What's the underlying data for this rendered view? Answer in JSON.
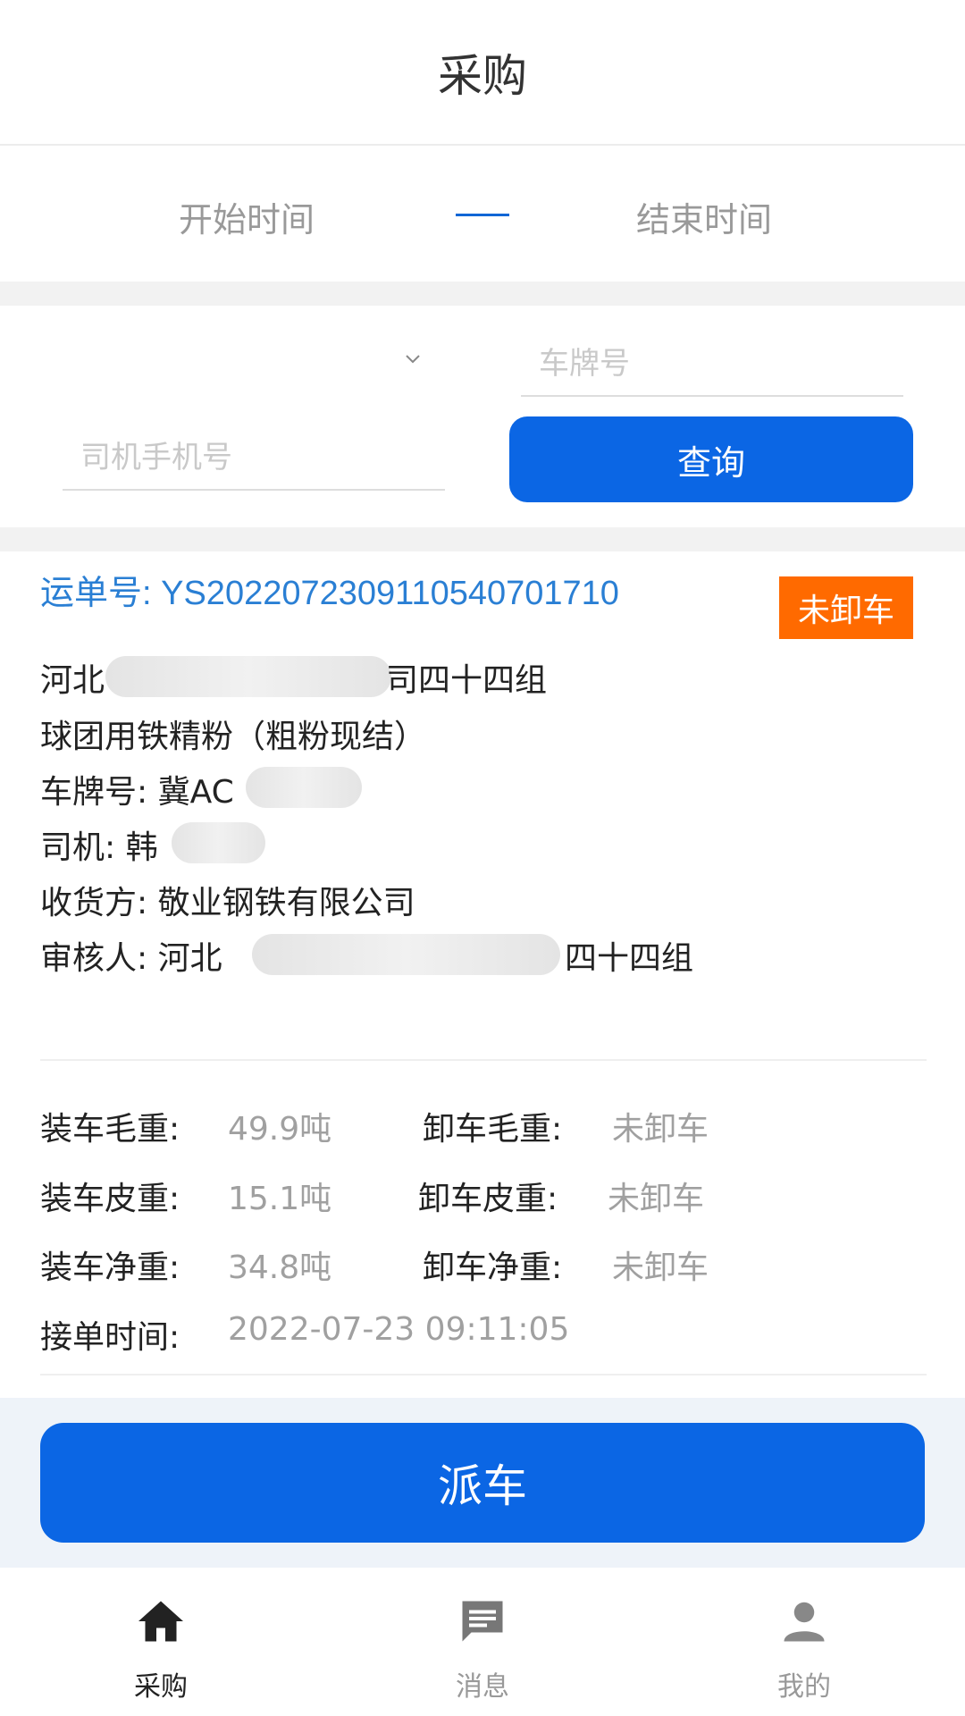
{
  "header": {
    "title": "采购"
  },
  "date_range": {
    "start": "开始时间",
    "end": "结束时间"
  },
  "filters": {
    "plate_placeholder": "车牌号",
    "phone_placeholder": "司机手机号",
    "query_label": "查询"
  },
  "order": {
    "order_no": "运单号: YS20220723091105407017​10",
    "status": "未卸车",
    "supplier_prefix": "河北",
    "supplier_suffix": "司四十四组",
    "product": "球团用铁精粉（粗粉现结）",
    "plate_label": "车牌号: 冀AC",
    "driver_label": "司机: 韩",
    "receiver": "收货方: 敬业钢铁有限公司",
    "reviewer_prefix": "审核人:  河北",
    "reviewer_suffix": "四十四组",
    "weights": {
      "load_gross_label": "装车毛重:",
      "load_gross_value": "49.9吨",
      "unload_gross_label": "卸车毛重:",
      "unload_gross_value": "未卸车",
      "load_tare_label": "装车皮重:",
      "load_tare_value": "15.1吨",
      "unload_tare_label": "卸车皮重:",
      "unload_tare_value": "未卸车",
      "load_net_label": "装车净重:",
      "load_net_value": "34.8吨",
      "unload_net_label": "卸车净重:",
      "unload_net_value": "未卸车"
    },
    "accept_time_label": "接单时间:",
    "accept_time_value": "2022-07-23 09:11:05"
  },
  "dispatch": {
    "label": "派车"
  },
  "tabbar": {
    "items": [
      {
        "label": "采购",
        "icon": "home-icon",
        "active": true
      },
      {
        "label": "消息",
        "icon": "message-icon",
        "active": false
      },
      {
        "label": "我的",
        "icon": "user-icon",
        "active": false
      }
    ],
    "active_color": "#222222",
    "inactive_color": "#999999"
  },
  "colors": {
    "primary": "#0b66e4",
    "order_no": "#2a7fd4",
    "status_badge": "#ff6a00"
  }
}
